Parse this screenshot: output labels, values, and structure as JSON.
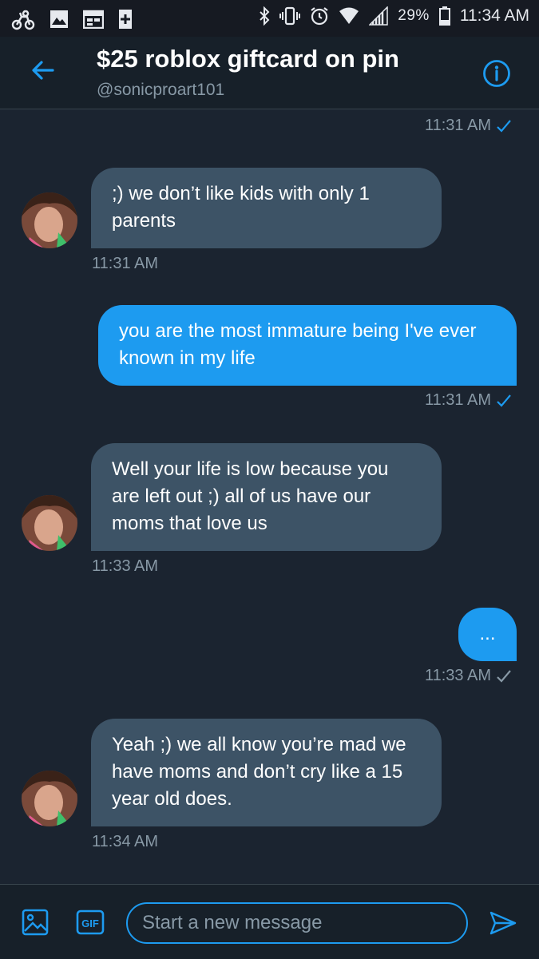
{
  "status_bar": {
    "icons_left": [
      "bike-notification-icon",
      "image-notification-icon",
      "calendar-notification-icon",
      "plus-box-notification-icon"
    ],
    "icons_right": [
      "bluetooth-icon",
      "vibrate-icon",
      "alarm-icon",
      "wifi-icon",
      "signal-icon",
      "battery-icon"
    ],
    "battery": "29%",
    "time": "11:34 AM"
  },
  "header": {
    "title": "$25 roblox giftcard on pin",
    "handle": "@sonicproart101"
  },
  "messages": [
    {
      "direction": "out",
      "text": "",
      "time": "11:31 AM",
      "read": true
    },
    {
      "direction": "in",
      "text": ";) we don’t like kids with only 1 parents",
      "time": "11:31 AM"
    },
    {
      "direction": "out",
      "text": "you are the most immature being I've ever known in my life",
      "time": "11:31 AM",
      "read": true
    },
    {
      "direction": "in",
      "text": "Well your life is low because you are left out ;) all of us have our moms that love us",
      "time": "11:33 AM"
    },
    {
      "direction": "out",
      "text": "...",
      "time": "11:33 AM",
      "read": false
    },
    {
      "direction": "in",
      "text": "Yeah ;) we all know you’re mad we have moms and don’t cry like a 15 year old does.",
      "time": "11:34 AM"
    }
  ],
  "composer": {
    "placeholder": "Start a new message",
    "gif_label": "GIF"
  },
  "colors": {
    "accent": "#1d9bf0",
    "incoming_bubble": "#3d5366",
    "background": "#1b2430",
    "secondary_text": "#8899a6"
  }
}
